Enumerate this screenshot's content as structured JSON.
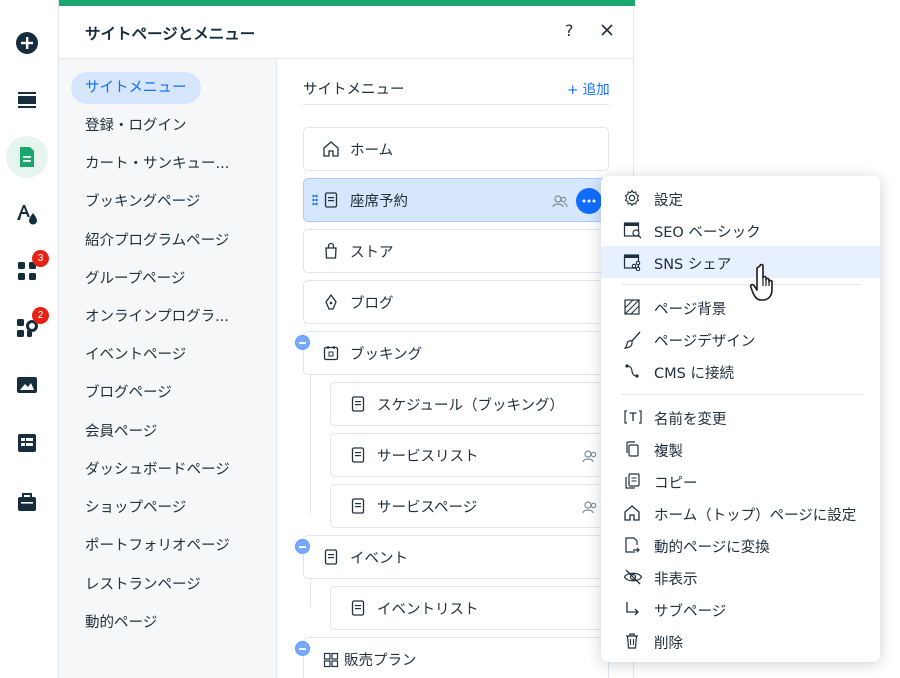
{
  "sidebar_rail": {
    "items": [
      {
        "name": "add-icon"
      },
      {
        "name": "sections-icon"
      },
      {
        "name": "pages-icon",
        "active": true
      },
      {
        "name": "theme-icon"
      },
      {
        "name": "apps-icon",
        "badge": "3"
      },
      {
        "name": "business-apps-icon",
        "badge": "2"
      },
      {
        "name": "media-icon"
      },
      {
        "name": "cms-icon"
      },
      {
        "name": "portfolio-icon"
      }
    ]
  },
  "panel": {
    "title": "サイトページとメニュー",
    "help": "?",
    "accent_color": "#1aa66d"
  },
  "categories": [
    {
      "label": "サイトメニュー",
      "selected": true
    },
    {
      "label": "登録・ログイン"
    },
    {
      "label": "カート・サンキュー..."
    },
    {
      "label": "ブッキングページ"
    },
    {
      "label": "紹介プログラムページ"
    },
    {
      "label": "グループページ"
    },
    {
      "label": "オンラインプログラ..."
    },
    {
      "label": "イベントページ"
    },
    {
      "label": "ブログページ"
    },
    {
      "label": "会員ページ"
    },
    {
      "label": "ダッシュボードページ"
    },
    {
      "label": "ショップページ"
    },
    {
      "label": "ポートフォリオページ"
    },
    {
      "label": "レストランページ"
    },
    {
      "label": "動的ページ"
    }
  ],
  "menu": {
    "heading": "サイトメニュー",
    "add_label": "+ 追加",
    "pages": [
      {
        "label": "ホーム",
        "icon": "home-icon"
      },
      {
        "label": "座席予約",
        "icon": "page-icon",
        "selected": true
      },
      {
        "label": "ストア",
        "icon": "bag-icon"
      },
      {
        "label": "ブログ",
        "icon": "pen-icon"
      },
      {
        "label": "ブッキング",
        "icon": "calendar-icon"
      },
      {
        "label": "スケジュール（ブッキング）",
        "icon": "page-icon"
      },
      {
        "label": "サービスリスト",
        "icon": "page-icon"
      },
      {
        "label": "サービスページ",
        "icon": "page-icon"
      },
      {
        "label": "イベント",
        "icon": "page-icon"
      },
      {
        "label": "イベントリスト",
        "icon": "page-icon"
      },
      {
        "label": "販売プラン",
        "icon": "grid-icon"
      }
    ]
  },
  "context_menu": {
    "items": [
      {
        "label": "設定",
        "icon": "gear-icon"
      },
      {
        "label": "SEO ベーシック",
        "icon": "seo-icon"
      },
      {
        "label": "SNS シェア",
        "icon": "social-share-icon",
        "hover": true
      },
      {
        "label": "ページ背景",
        "icon": "background-icon"
      },
      {
        "label": "ページデザイン",
        "icon": "brush-icon"
      },
      {
        "label": "CMS に接続",
        "icon": "connect-icon"
      },
      {
        "label": "名前を変更",
        "icon": "rename-icon"
      },
      {
        "label": "複製",
        "icon": "duplicate-icon"
      },
      {
        "label": "コピー",
        "icon": "copy-icon"
      },
      {
        "label": "ホーム（トップ）ページに設定",
        "icon": "home-icon"
      },
      {
        "label": "動的ページに変換",
        "icon": "convert-icon"
      },
      {
        "label": "非表示",
        "icon": "hide-icon"
      },
      {
        "label": "サブページ",
        "icon": "subpage-icon"
      },
      {
        "label": "削除",
        "icon": "delete-icon"
      }
    ]
  },
  "colors": {
    "accent_blue": "#116dff",
    "selected_bg": "#d5e6fd",
    "badge_red": "#e62214"
  }
}
